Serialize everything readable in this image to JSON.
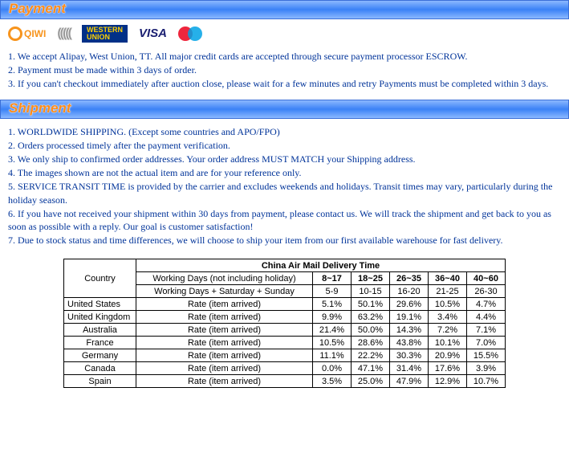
{
  "sections": {
    "payment_title": "Payment",
    "shipment_title": "Shipment"
  },
  "payment_notes": [
    "1. We accept Alipay, West Union, TT. All major credit cards are accepted through secure payment processor ESCROW.",
    "2. Payment must be made within 3 days of order.",
    "3. If you can't checkout immediately after auction close, please wait for a few minutes and retry Payments must be completed within 3 days."
  ],
  "shipment_notes": [
    "1. WORLDWIDE SHIPPING. (Except some countries and APO/FPO)",
    "2. Orders processed timely after the payment verification.",
    "3. We only ship to confirmed order addresses. Your order address MUST MATCH your Shipping address.",
    "4. The images shown are not the actual item and are for your reference only.",
    "5. SERVICE TRANSIT TIME is provided by the carrier and excludes weekends and holidays. Transit times may vary, particularly during the holiday season.",
    "6. If you have not received your shipment within 30 days from payment, please contact us. We will track the shipment and get back to you as soon as possible with a reply. Our goal is customer satisfaction!",
    "7. Due to stock status and time differences, we will choose to ship your item from our first available warehouse for fast delivery."
  ],
  "table": {
    "title": "China Air Mail Delivery Time",
    "country_header": "Country",
    "row1_label": "Working Days (not including holiday)",
    "row1_ranges": [
      "8~17",
      "18~25",
      "26~35",
      "36~40",
      "40~60"
    ],
    "row2_label": "Working Days + Saturday + Sunday",
    "row2_ranges": [
      "5-9",
      "10-15",
      "16-20",
      "21-25",
      "26-30"
    ],
    "rate_label": "Rate (item arrived)",
    "rows": [
      {
        "country": "United States",
        "rates": [
          "5.1%",
          "50.1%",
          "29.6%",
          "10.5%",
          "4.7%"
        ]
      },
      {
        "country": "United Kingdom",
        "rates": [
          "9.9%",
          "63.2%",
          "19.1%",
          "3.4%",
          "4.4%"
        ]
      },
      {
        "country": "Australia",
        "rates": [
          "21.4%",
          "50.0%",
          "14.3%",
          "7.2%",
          "7.1%"
        ]
      },
      {
        "country": "France",
        "rates": [
          "10.5%",
          "28.6%",
          "43.8%",
          "10.1%",
          "7.0%"
        ]
      },
      {
        "country": "Germany",
        "rates": [
          "11.1%",
          "22.2%",
          "30.3%",
          "20.9%",
          "15.5%"
        ]
      },
      {
        "country": "Canada",
        "rates": [
          "0.0%",
          "47.1%",
          "31.4%",
          "17.6%",
          "3.9%"
        ]
      },
      {
        "country": "Spain",
        "rates": [
          "3.5%",
          "25.0%",
          "47.9%",
          "12.9%",
          "10.7%"
        ]
      }
    ]
  },
  "logos": {
    "qiwi": "QIWI",
    "visa": "VISA",
    "wu_line1": "WESTERN",
    "wu_line2": "UNION"
  }
}
